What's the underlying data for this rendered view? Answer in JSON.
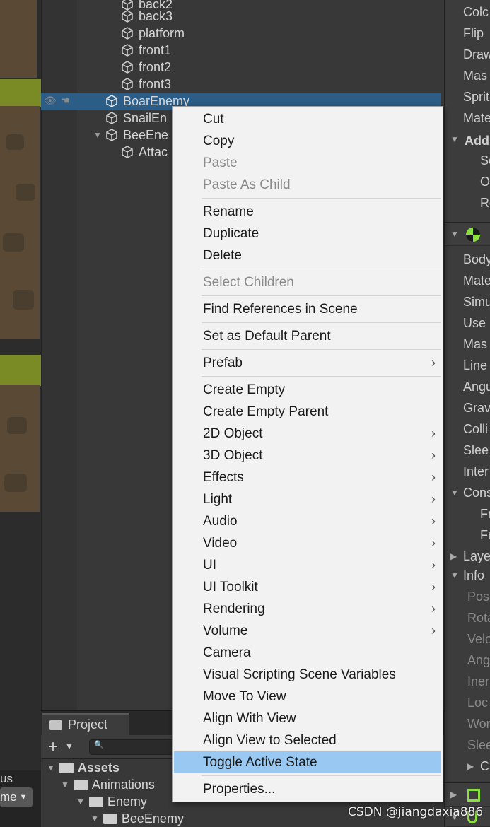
{
  "hierarchy": {
    "items": [
      {
        "label": "back2"
      },
      {
        "label": "back3"
      },
      {
        "label": "platform"
      },
      {
        "label": "front1"
      },
      {
        "label": "front2"
      },
      {
        "label": "front3"
      },
      {
        "label": "BoarEnemy"
      },
      {
        "label": "SnailEn"
      },
      {
        "label": "BeeEne"
      },
      {
        "label": "Attac"
      }
    ]
  },
  "menu": {
    "items": [
      {
        "label": "Cut"
      },
      {
        "label": "Copy"
      },
      {
        "label": "Paste"
      },
      {
        "label": "Paste As Child"
      },
      {
        "label": "Rename"
      },
      {
        "label": "Duplicate"
      },
      {
        "label": "Delete"
      },
      {
        "label": "Select Children"
      },
      {
        "label": "Find References in Scene"
      },
      {
        "label": "Set as Default Parent"
      },
      {
        "label": "Prefab"
      },
      {
        "label": "Create Empty"
      },
      {
        "label": "Create Empty Parent"
      },
      {
        "label": "2D Object"
      },
      {
        "label": "3D Object"
      },
      {
        "label": "Effects"
      },
      {
        "label": "Light"
      },
      {
        "label": "Audio"
      },
      {
        "label": "Video"
      },
      {
        "label": "UI"
      },
      {
        "label": "UI Toolkit"
      },
      {
        "label": "Rendering"
      },
      {
        "label": "Volume"
      },
      {
        "label": "Camera"
      },
      {
        "label": "Visual Scripting Scene Variables"
      },
      {
        "label": "Move To View"
      },
      {
        "label": "Align With View"
      },
      {
        "label": "Align View to Selected"
      },
      {
        "label": "Toggle Active State"
      },
      {
        "label": "Properties..."
      }
    ],
    "submenu_glyph": "›"
  },
  "inspector": {
    "rows": [
      {
        "label": "Colc"
      },
      {
        "label": "Flip"
      },
      {
        "label": "Draw"
      },
      {
        "label": "Mas"
      },
      {
        "label": "Sprit"
      },
      {
        "label": "Mate"
      },
      {
        "label": "Add"
      },
      {
        "label": "Sc"
      },
      {
        "label": "O"
      },
      {
        "label": "Re"
      },
      {
        "label": "Body"
      },
      {
        "label": "Mate"
      },
      {
        "label": "Simu"
      },
      {
        "label": "Use"
      },
      {
        "label": "Mas"
      },
      {
        "label": "Line"
      },
      {
        "label": "Angu"
      },
      {
        "label": "Grav"
      },
      {
        "label": "Colli"
      },
      {
        "label": "Slee"
      },
      {
        "label": "Inter"
      },
      {
        "label": "Cons"
      },
      {
        "label": "Fr"
      },
      {
        "label": "Fr"
      },
      {
        "label": "Laye"
      },
      {
        "label": "Info"
      },
      {
        "label": "Pos"
      },
      {
        "label": "Rota"
      },
      {
        "label": "Velo"
      },
      {
        "label": "Ang"
      },
      {
        "label": "Iner"
      },
      {
        "label": "Loc"
      },
      {
        "label": "Wor"
      },
      {
        "label": "Slee"
      },
      {
        "label": "C"
      }
    ]
  },
  "project": {
    "tab_label": "Project",
    "add_glyph": "+",
    "search_glyph": "🔍",
    "tree": [
      {
        "label": "Assets"
      },
      {
        "label": "Animations"
      },
      {
        "label": "Enemy"
      },
      {
        "label": "BeeEnemy"
      }
    ]
  },
  "bottom_left": {
    "label": "us",
    "dropdown": "me"
  },
  "watermark": "CSDN @jiangdaxia886",
  "colors": {
    "selection": "#2c5d87",
    "menu_highlight": "#99c9f2",
    "menu_bg": "#f2f2f2"
  }
}
